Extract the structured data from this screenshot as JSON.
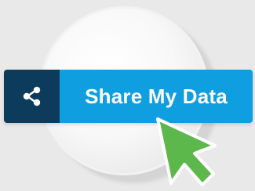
{
  "button": {
    "label": "Share My Data",
    "icon": "share-icon"
  },
  "cursor": {
    "icon": "arrow-cursor-icon"
  },
  "colors": {
    "background": "#e9e9e9",
    "icon_block": "#0d3b5c",
    "button": "#0f9ee0",
    "label_text": "#ffffff",
    "cursor": "#5cb84a"
  }
}
